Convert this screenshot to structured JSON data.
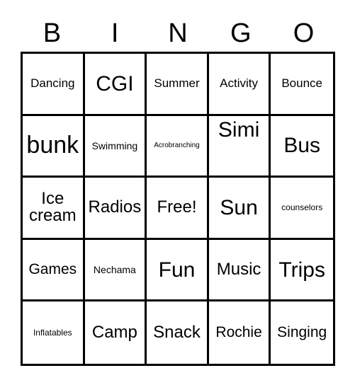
{
  "card": {
    "title": "BINGO",
    "background_color": "#ffffff",
    "line_color": "#000000",
    "text_color": "#000000",
    "columns": 5,
    "rows": 5
  },
  "header": {
    "letters": [
      "B",
      "I",
      "N",
      "G",
      "O"
    ]
  },
  "grid": {
    "rows": [
      [
        {
          "label": "Dancing",
          "size": "m",
          "free": false
        },
        {
          "label": "CGI",
          "size": "xxl",
          "free": false
        },
        {
          "label": "Summer",
          "size": "m",
          "free": false
        },
        {
          "label": "Activity",
          "size": "m",
          "free": false
        },
        {
          "label": "Bounce",
          "size": "m",
          "free": false
        }
      ],
      [
        {
          "label": "bunk",
          "size": "huge",
          "free": false
        },
        {
          "label": "Swimming",
          "size": "s",
          "free": false
        },
        {
          "label": "Acrobranching",
          "size": "xxs",
          "free": false
        },
        {
          "label": "Simi",
          "size": "xxl",
          "free": false,
          "align": "top"
        },
        {
          "label": "Bus",
          "size": "xxl",
          "free": false
        }
      ],
      [
        {
          "label": "Ice cream",
          "size": "xl",
          "free": false
        },
        {
          "label": "Radios",
          "size": "xl",
          "free": false
        },
        {
          "label": "Free!",
          "size": "xl",
          "free": true
        },
        {
          "label": "Sun",
          "size": "xxl",
          "free": false
        },
        {
          "label": "counselors",
          "size": "xs",
          "free": false
        }
      ],
      [
        {
          "label": "Games",
          "size": "l",
          "free": false
        },
        {
          "label": "Nechama",
          "size": "s",
          "free": false
        },
        {
          "label": "Fun",
          "size": "xxl",
          "free": false
        },
        {
          "label": "Music",
          "size": "xl",
          "free": false
        },
        {
          "label": "Trips",
          "size": "xxl",
          "free": false
        }
      ],
      [
        {
          "label": "Inflatables",
          "size": "xs",
          "free": false
        },
        {
          "label": "Camp",
          "size": "xl",
          "free": false
        },
        {
          "label": "Snack",
          "size": "xl",
          "free": false
        },
        {
          "label": "Rochie",
          "size": "l",
          "free": false
        },
        {
          "label": "Singing",
          "size": "l",
          "free": false
        }
      ]
    ]
  }
}
